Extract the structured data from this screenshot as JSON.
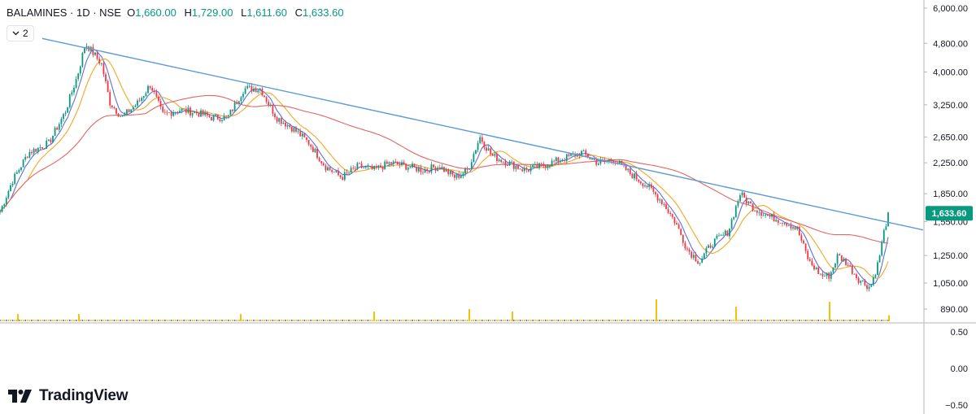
{
  "header": {
    "symbol": "BALAMINES · 1D · NSE",
    "o_key": "O",
    "o_val": "1,660.00",
    "h_key": "H",
    "h_val": "1,729.00",
    "l_key": "L",
    "l_val": "1,611.60",
    "c_key": "C",
    "c_val": "1,633.60"
  },
  "indicator_toggle": {
    "count": "2",
    "icon": "chevron-down-icon"
  },
  "branding": {
    "name": "TradingView",
    "icon": "tradingview-logo-icon"
  },
  "colors": {
    "up": "#089981",
    "down": "#f23645",
    "trendline": "#5b9bd5",
    "ma_fast": "#5d6fd8",
    "ma_mid": "#f5a623",
    "ma_slow": "#e06666",
    "volume": "#f4c20d",
    "last_price_bg": "#089981"
  },
  "chart_data": {
    "type": "candlestick",
    "y_scale": "log",
    "ylim": [
      890,
      6000
    ],
    "price_ticks": [
      "6,000.00",
      "4,800.00",
      "4,000.00",
      "3,250.00",
      "2,650.00",
      "2,250.00",
      "1,850.00",
      "1,550.00",
      "1,250.00",
      "1,050.00",
      "890.00"
    ],
    "last_price": "1,633.60",
    "oscillator_ticks": [
      "0.50",
      "0.00",
      "−0.50"
    ],
    "price_path": [
      [
        0,
        1650
      ],
      [
        15,
        2000
      ],
      [
        35,
        2400
      ],
      [
        60,
        2550
      ],
      [
        80,
        3100
      ],
      [
        95,
        3900
      ],
      [
        105,
        4800
      ],
      [
        115,
        4500
      ],
      [
        125,
        4200
      ],
      [
        135,
        3300
      ],
      [
        150,
        3000
      ],
      [
        170,
        3300
      ],
      [
        185,
        3700
      ],
      [
        200,
        3050
      ],
      [
        220,
        3150
      ],
      [
        240,
        3100
      ],
      [
        260,
        3000
      ],
      [
        280,
        3000
      ],
      [
        300,
        3600
      ],
      [
        320,
        3600
      ],
      [
        340,
        3000
      ],
      [
        360,
        2800
      ],
      [
        380,
        2550
      ],
      [
        400,
        2200
      ],
      [
        420,
        2050
      ],
      [
        440,
        2200
      ],
      [
        460,
        2150
      ],
      [
        480,
        2250
      ],
      [
        500,
        2200
      ],
      [
        520,
        2150
      ],
      [
        540,
        2200
      ],
      [
        560,
        2050
      ],
      [
        575,
        2150
      ],
      [
        590,
        2650
      ],
      [
        605,
        2350
      ],
      [
        625,
        2250
      ],
      [
        645,
        2150
      ],
      [
        665,
        2200
      ],
      [
        690,
        2300
      ],
      [
        715,
        2400
      ],
      [
        735,
        2250
      ],
      [
        755,
        2300
      ],
      [
        775,
        2100
      ],
      [
        795,
        1950
      ],
      [
        815,
        1750
      ],
      [
        830,
        1550
      ],
      [
        845,
        1300
      ],
      [
        860,
        1200
      ],
      [
        875,
        1350
      ],
      [
        895,
        1450
      ],
      [
        910,
        1850
      ],
      [
        925,
        1700
      ],
      [
        945,
        1600
      ],
      [
        965,
        1550
      ],
      [
        980,
        1480
      ],
      [
        995,
        1200
      ],
      [
        1010,
        1100
      ],
      [
        1020,
        1100
      ],
      [
        1030,
        1250
      ],
      [
        1040,
        1200
      ],
      [
        1055,
        1080
      ],
      [
        1070,
        1020
      ],
      [
        1080,
        1200
      ],
      [
        1088,
        1500
      ],
      [
        1093,
        1633
      ]
    ],
    "trendline": [
      [
        52,
        4950
      ],
      [
        1135,
        1470
      ]
    ],
    "volume_spikes": [
      [
        22,
        0.3
      ],
      [
        97,
        0.3
      ],
      [
        296,
        0.3
      ],
      [
        460,
        0.4
      ],
      [
        577,
        0.5
      ],
      [
        630,
        0.4
      ],
      [
        807,
        0.9
      ],
      [
        905,
        0.6
      ],
      [
        1020,
        0.8
      ],
      [
        1093,
        0.25
      ]
    ]
  }
}
